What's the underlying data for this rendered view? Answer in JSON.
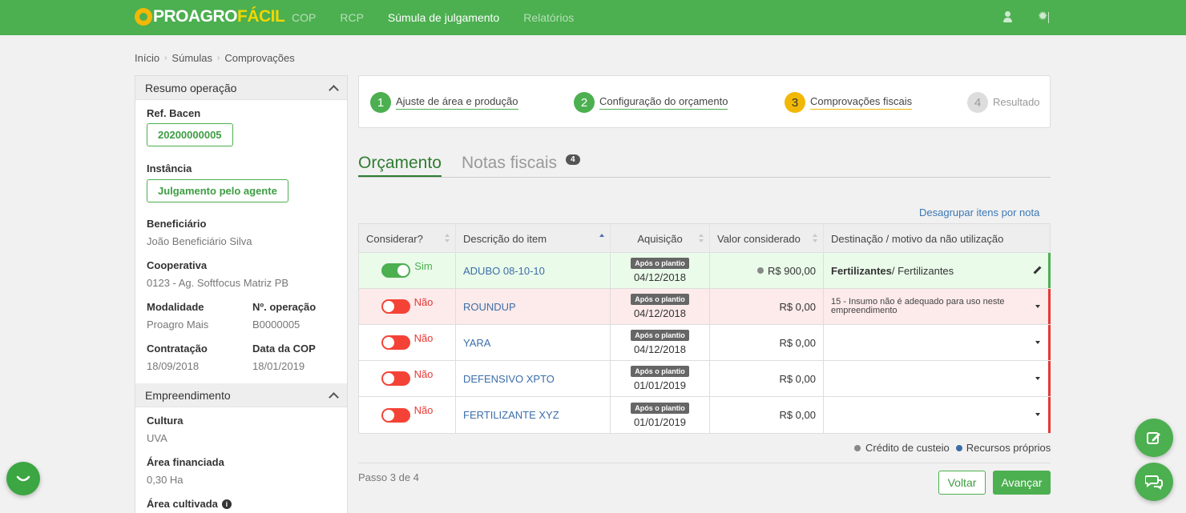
{
  "app": {
    "logo_text_main": "PROAGRO",
    "logo_text_accent": "FÁCIL",
    "nav": [
      {
        "label": "COP"
      },
      {
        "label": "RCP"
      },
      {
        "label": "Súmula de julgamento"
      },
      {
        "label": "Relatórios"
      }
    ]
  },
  "breadcrumb": [
    "Início",
    "Súmulas",
    "Comprovações"
  ],
  "sidebar": {
    "resumo_title": "Resumo operação",
    "ref_bacen_label": "Ref. Bacen",
    "ref_bacen_value": "20200000005",
    "instancia_label": "Instância",
    "instancia_value": "Julgamento pelo agente",
    "beneficiario_label": "Beneficiário",
    "beneficiario_value": "João Beneficiário Silva",
    "cooperativa_label": "Cooperativa",
    "cooperativa_value": "0123 - Ag. Softfocus Matriz PB",
    "modalidade_label": "Modalidade",
    "modalidade_value": "Proagro Mais",
    "n_operacao_label": "Nº. operação",
    "n_operacao_value": "B0000005",
    "contratacao_label": "Contratação",
    "contratacao_value": "18/09/2018",
    "data_cop_label": "Data da COP",
    "data_cop_value": "18/01/2019",
    "empreendimento_title": "Empreendimento",
    "cultura_label": "Cultura",
    "cultura_value": "UVA",
    "area_fin_label": "Área financiada",
    "area_fin_value": "0,30 Ha",
    "area_cult_label": "Área cultivada"
  },
  "stepper": [
    {
      "num": "1",
      "label": "Ajuste de área e produção"
    },
    {
      "num": "2",
      "label": "Configuração do orçamento"
    },
    {
      "num": "3",
      "label": "Comprovações fiscais"
    },
    {
      "num": "4",
      "label": "Resultado"
    }
  ],
  "tabs": {
    "orcamento": "Orçamento",
    "notas": "Notas fiscais",
    "notas_count": "4"
  },
  "ungroup_link": "Desagrupar itens por nota",
  "table": {
    "headers": [
      "Considerar?",
      "Descrição do item",
      "Aquisição",
      "Valor considerado",
      "Destinação / motivo da não utilização"
    ],
    "acq_badge": "Após o plantio",
    "rows": [
      {
        "toggle": "Sim",
        "item": "ADUBO 08-10-10",
        "date": "04/12/2018",
        "value": "R$ 900,00",
        "dest_bold": "Fertilizantes",
        "dest_rest": " / Fertilizantes",
        "reason": ""
      },
      {
        "toggle": "Não",
        "item": "ROUNDUP",
        "date": "04/12/2018",
        "value": "R$ 0,00",
        "dest_bold": "",
        "dest_rest": "",
        "reason": "15 - Insumo não é adequado para uso neste empreendimento"
      },
      {
        "toggle": "Não",
        "item": "YARA",
        "date": "04/12/2018",
        "value": "R$ 0,00",
        "dest_bold": "",
        "dest_rest": "",
        "reason": ""
      },
      {
        "toggle": "Não",
        "item": "DEFENSIVO XPTO",
        "date": "01/01/2019",
        "value": "R$ 0,00",
        "dest_bold": "",
        "dest_rest": "",
        "reason": ""
      },
      {
        "toggle": "Não",
        "item": "FERTILIZANTE XYZ",
        "date": "01/01/2019",
        "value": "R$ 0,00",
        "dest_bold": "",
        "dest_rest": "",
        "reason": ""
      }
    ]
  },
  "legend": {
    "credito": "Crédito de custeio",
    "recursos": "Recursos próprios"
  },
  "footer": {
    "step_count": "Passo 3 de 4",
    "back": "Voltar",
    "next": "Avançar"
  },
  "colors": {
    "brand_green": "#4caf50",
    "accent_yellow": "#f2b807",
    "off_red": "#e53935",
    "link_blue": "#3b6ea8"
  }
}
